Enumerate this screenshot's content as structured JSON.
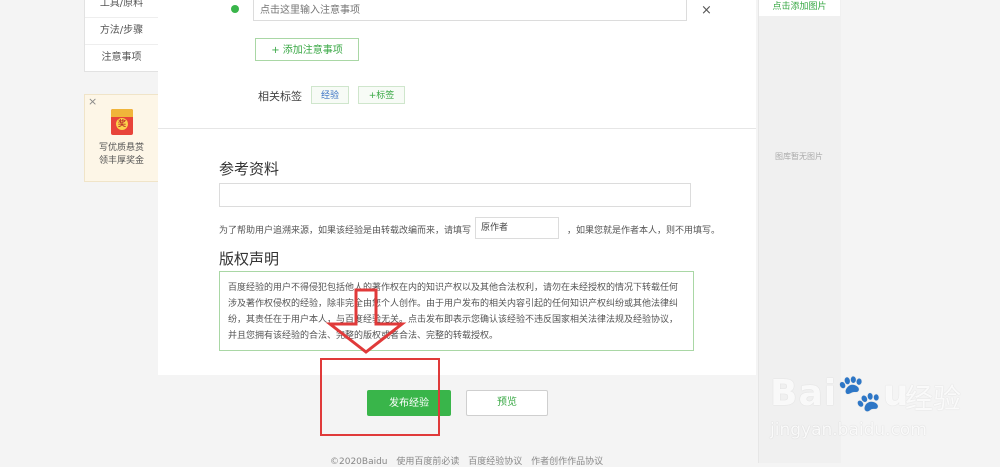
{
  "left_nav": {
    "items": [
      {
        "label": "工具/原料"
      },
      {
        "label": "方法/步骤"
      },
      {
        "label": "注意事项"
      }
    ]
  },
  "promo": {
    "close": "×",
    "badge": "奖",
    "line1": "写优质悬赏",
    "line2": "领丰厚奖金"
  },
  "note": {
    "placeholder": "点击这里输入注意事项",
    "close": "×"
  },
  "add_note_button": "+ 添加注意事项",
  "tags": {
    "label": "相关标签",
    "items": [
      "经验",
      "+标签"
    ]
  },
  "reference": {
    "title": "参考资料",
    "source_text_before": "为了帮助用户追溯来源，如果该经验是由转载改编而来，请填写",
    "source_input_value": "原作者",
    "source_text_after": "，如果您就是作者本人，则不用填写。"
  },
  "copyright": {
    "title": "版权声明",
    "text": "百度经验的用户不得侵犯包括他人的著作权在内的知识产权以及其他合法权利，请勿在未经授权的情况下转载任何涉及著作权侵权的经验，除非完全由您个人创作。由于用户发布的相关内容引起的任何知识产权纠纷或其他法律纠纷，其责任在于用户本人，与百度经验无关。点击发布即表示您确认该经验不违反国家相关法律法规及经验协议，并且您拥有该经验的合法、完整的版权或者合法、完整的转载授权。"
  },
  "right_col": {
    "add_image": "点击添加图片",
    "no_image": "图库暂无图片"
  },
  "actions": {
    "publish": "发布经验",
    "preview": "预览"
  },
  "footer": {
    "copyright": "©2020Baidu",
    "links": [
      "使用百度前必读",
      "百度经验协议",
      "作者创作作品协议"
    ]
  },
  "watermark": {
    "logo": "Bai🐾u",
    "logo_cn": "经验",
    "url": "jingyan.baidu.com"
  },
  "colors": {
    "green": "#39b54a",
    "annotation_red": "#e03a3a"
  }
}
